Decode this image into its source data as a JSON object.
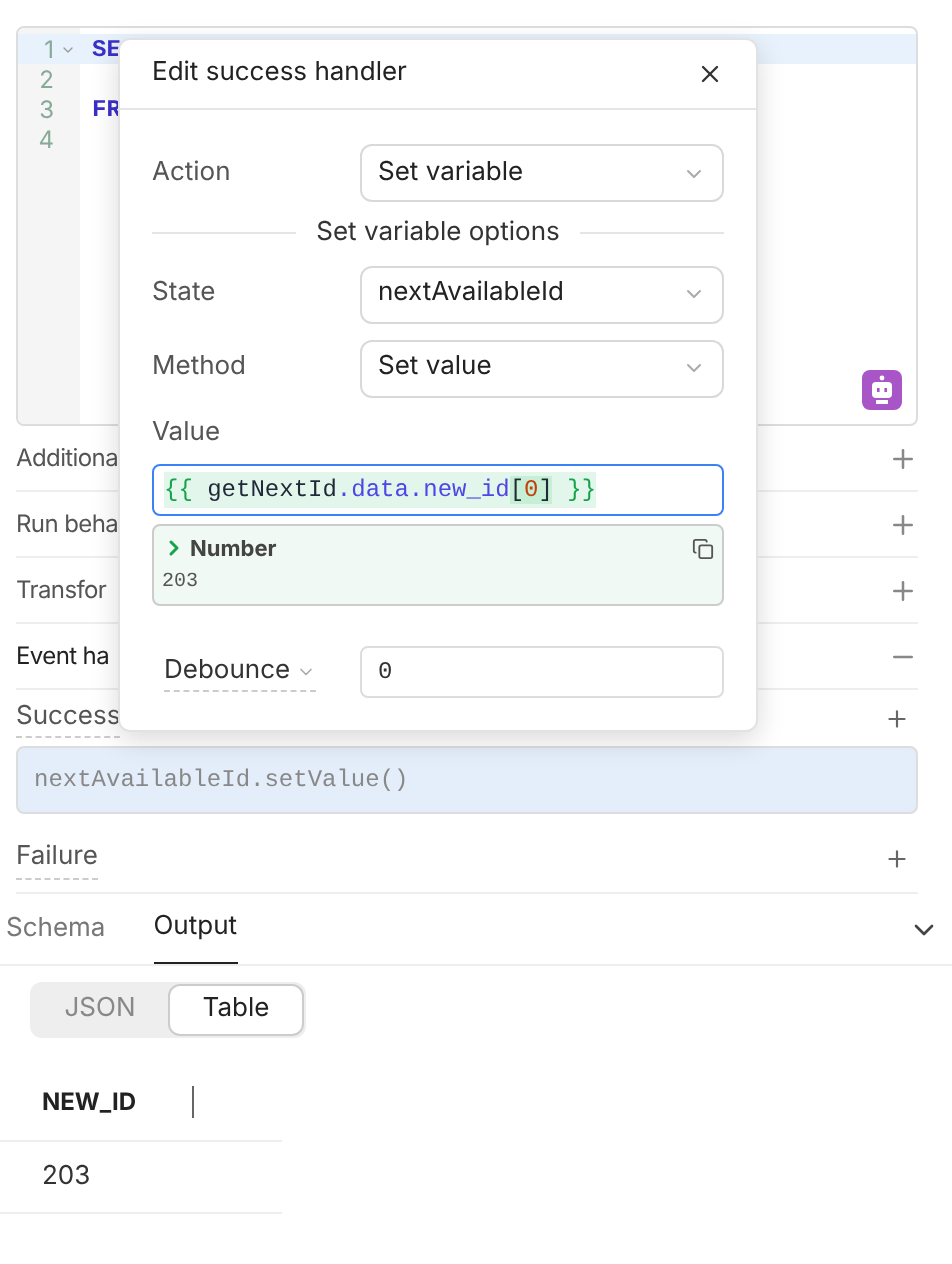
{
  "editor": {
    "lines": [
      {
        "number": "1",
        "code": "SE",
        "active": true,
        "foldable": true
      },
      {
        "number": "2",
        "active": false,
        "foldable": false
      },
      {
        "number": "3",
        "code": "FR",
        "active": false,
        "foldable": false
      },
      {
        "number": "4",
        "active": false,
        "foldable": false
      }
    ]
  },
  "sections": [
    {
      "label": "Additiona",
      "expanded": false
    },
    {
      "label": "Run beha",
      "expanded": false
    },
    {
      "label": "Transfor",
      "expanded": false
    },
    {
      "label": "Event ha",
      "expanded": true
    }
  ],
  "success": {
    "label": "Success",
    "handlers": [
      "nextAvailableId.setValue()"
    ]
  },
  "failure": {
    "label": "Failure"
  },
  "modal": {
    "title": "Edit success handler",
    "action": {
      "label": "Action",
      "value": "Set variable"
    },
    "divider": "Set variable options",
    "fields": [
      {
        "label": "State",
        "value": "nextAvailableId"
      },
      {
        "label": "Method",
        "value": "Set value"
      }
    ],
    "value_label": "Value",
    "value_tokens": [
      {
        "text": "{{ ",
        "kind": "brace"
      },
      {
        "text": "getNextId",
        "kind": "ident"
      },
      {
        "text": ".data.new_id",
        "kind": "prop"
      },
      {
        "text": "[",
        "kind": "bracket"
      },
      {
        "text": "0",
        "kind": "number"
      },
      {
        "text": "]",
        "kind": "bracket"
      },
      {
        "text": " }}",
        "kind": "brace"
      }
    ],
    "preview": {
      "type": "Number",
      "value": "203"
    },
    "debounce": {
      "label": "Debounce",
      "value": "0"
    }
  },
  "output": {
    "tabs": [
      {
        "label": "Schema",
        "selected": false
      },
      {
        "label": "Output",
        "selected": true
      }
    ],
    "views": [
      {
        "label": "JSON",
        "selected": false
      },
      {
        "label": "Table",
        "selected": true
      }
    ],
    "table": {
      "columns": [
        "NEW_ID"
      ],
      "rows": [
        [
          "203"
        ]
      ]
    }
  }
}
